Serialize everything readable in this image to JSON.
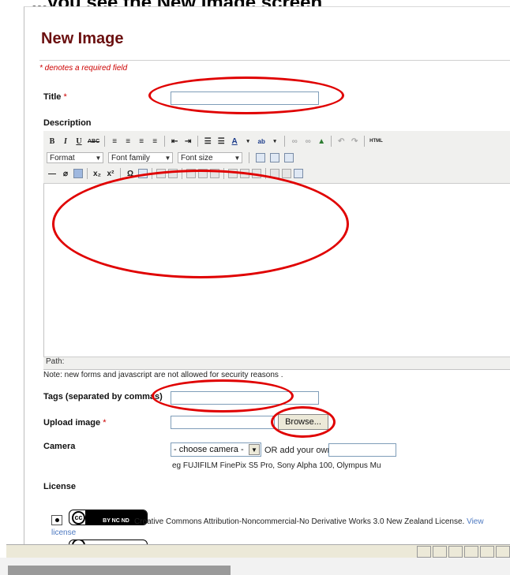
{
  "top_caption": "...you see the New Image screen",
  "page_title": "New Image",
  "required_note": "* denotes a required field",
  "title_field": {
    "label": "Title",
    "required_mark": "*",
    "value": ""
  },
  "description": {
    "label": "Description",
    "toolbar_row1": [
      "B",
      "I",
      "U",
      "ABC",
      "align-left",
      "align-center",
      "align-right",
      "align-justify",
      "outdent",
      "indent",
      "bullet-list",
      "numbered-list",
      "A",
      "ab",
      "link",
      "unlink",
      "image",
      "undo",
      "redo",
      "HTML"
    ],
    "format_select": "Format",
    "font_family_select": "Font family",
    "font_size_select": "Font size",
    "path_label": "Path:"
  },
  "security_note": "Note: new forms and javascript are not allowed for security reasons .",
  "tags": {
    "label": "Tags (separated by commas)",
    "value": ""
  },
  "upload": {
    "label": "Upload image",
    "required_mark": "*",
    "browse_label": "Browse..."
  },
  "camera": {
    "label": "Camera",
    "select_value": "- choose camera -",
    "or_text": "OR add your own",
    "custom_value": "",
    "example_text": "eg FUJIFILM FinePix S5 Pro, Sony Alpha 100, Olympus Mu"
  },
  "license": {
    "label": "License",
    "option_text": "Creative Commons Attribution-Noncommercial-No Derivative Works 3.0 New Zealand License.",
    "view_label": "View",
    "license_word": "license",
    "badge_cc": "cc",
    "badge_terms": "BY   NC   ND"
  },
  "colors": {
    "title": "#6b1010",
    "required": "#cc0000",
    "link": "#4d79c1",
    "annotation": "#e00000"
  }
}
